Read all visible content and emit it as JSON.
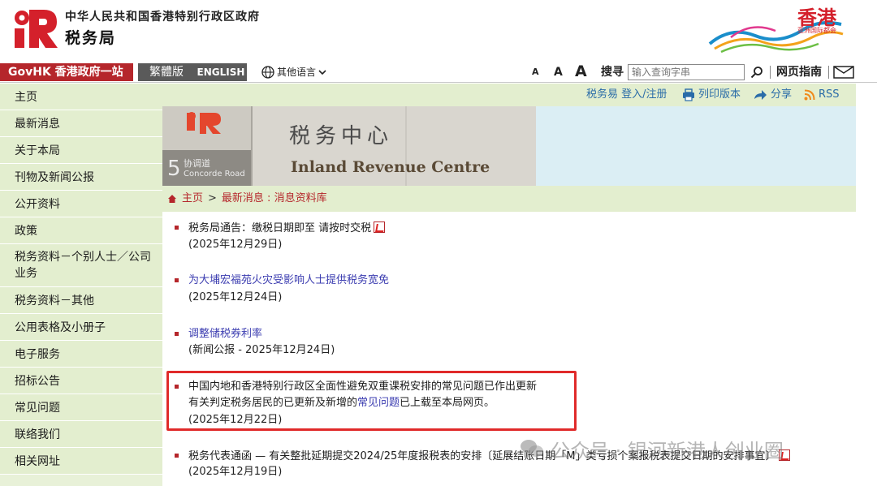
{
  "header": {
    "gov_title": "中华人民共和国香港特别行政区政府",
    "dept_title": "税务局",
    "brand_text": "香港",
    "brand_sub": "亚洲国际都会"
  },
  "topbar": {
    "govhk": "GovHK 香港政府一站通",
    "traditional": "繁體版",
    "english": "ENGLISH",
    "other_lang": "其他语言",
    "font_small": "A",
    "font_medium": "A",
    "font_large": "A",
    "search_label": "搜寻",
    "search_placeholder": "输入查询字串",
    "site_guide": "网页指南"
  },
  "sidebar": {
    "items": [
      {
        "label": "主页"
      },
      {
        "label": "最新消息"
      },
      {
        "label": "关于本局"
      },
      {
        "label": "刊物及新闻公报"
      },
      {
        "label": "公开资料"
      },
      {
        "label": "政策"
      },
      {
        "label": "税务资料－个别人士／公司业务"
      },
      {
        "label": "税务资料－其他"
      },
      {
        "label": "公用表格及小册子"
      },
      {
        "label": "电子服务"
      },
      {
        "label": "招标公告"
      },
      {
        "label": "常见问题"
      },
      {
        "label": "联络我们"
      },
      {
        "label": "相关网址"
      }
    ]
  },
  "toolbar": {
    "etax": "税务易 登入/注册",
    "print": "列印版本",
    "share": "分享",
    "rss": "RSS"
  },
  "banner": {
    "sign_cn": "税务中心",
    "sign_en": "Inland Revenue Centre",
    "address_num": "5",
    "address_cn": "协调道",
    "address_en": "Concorde Road"
  },
  "breadcrumb": {
    "home": "主页",
    "separator": ">",
    "current": "最新消息 : 消息资料库"
  },
  "news": [
    {
      "title": "税务局通告：缴税日期即至 请按时交税",
      "date": "(2025年12月29日)",
      "pdf": true
    },
    {
      "title": "为大埔宏福苑火灾受影响人士提供税务宽免",
      "date": "(2025年12月24日)",
      "pdf": false
    },
    {
      "title": "调整储税券利率",
      "date": "(新闻公报 - 2025年12月24日)",
      "pdf": false
    },
    {
      "title": "中国内地和香港特别行政区全面性避免双重课税安排的常见问题已作出更新",
      "line2_pre": "有关判定税务居民的已更新及新增的",
      "line2_link": "常见问题",
      "line2_post": "已上载至本局网页。",
      "date": "(2025年12月22日)",
      "pdf": false
    },
    {
      "title": "税务代表通函 — 有关整批延期提交2024/25年度报税表的安排〔延展结账日期「M」类亏损个案报税表提交日期的安排事宜〕",
      "date": "(2025年12月19日)",
      "pdf": true
    }
  ],
  "watermark": "公众号 · 银河新港人创业圈",
  "colors": {
    "accent_red": "#b5262b",
    "nav_green": "#e3eecf",
    "link_blue": "#3b3cb0",
    "highlight_red": "#e02a2a"
  }
}
